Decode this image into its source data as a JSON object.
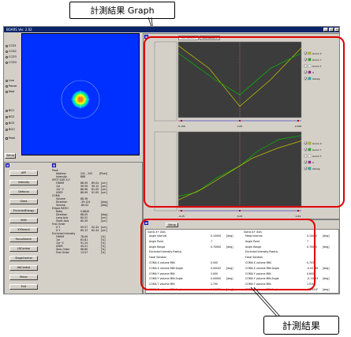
{
  "callouts": {
    "graph": "計測結果 Graph",
    "results": "計測結果"
  },
  "window": {
    "title": "BOARS Ver. 2.02"
  },
  "camera_radios": [
    "CCD1",
    "CCD2",
    "CCD3",
    "CCD4"
  ],
  "mode_radios": [
    "Live",
    "Pause",
    "Mod"
  ],
  "bg_radios": [
    "BG1",
    "BG2",
    "BG3",
    "BGO"
  ],
  "check_peak": "Peak",
  "setup_label": "Setup",
  "left_buttons": [
    "APP",
    "Intensity",
    "Defocus",
    "Glass",
    "EncircledEnergy",
    "Shift",
    "XYSearch",
    "FocusSearch",
    "LDControl",
    "StageControl",
    "AttControl",
    "Mirror",
    "Exit"
  ],
  "params": {
    "peak_title": "Peak",
    "address_label": "Address",
    "address_value": "241 , 242",
    "address_unit": "[Pixel]",
    "intensity_label": "Intensity",
    "intensity_value": "888",
    "spot_size_title": "SPOT SIZE X,Y",
    "rows1": [
      {
        "label": "FWHM",
        "v1": "88.59",
        "v2": "89.04",
        "unit": "[um]"
      },
      {
        "label": "1/e",
        "v1": "99.59",
        "v2": "99.12",
        "unit": "[um]"
      },
      {
        "label": "1/e^2",
        "v1": "88.96",
        "v2": "81.05",
        "unit": "[um]"
      },
      {
        "label": "USER",
        "v1": "88.99",
        "v2": "91.00",
        "unit": "[um]"
      }
    ],
    "coma_title": "COMA",
    "rows2": [
      {
        "label": "Volume",
        "v1": "88.36",
        "unit": ""
      },
      {
        "label": "Direction",
        "v1": "-39.124",
        "unit": "[deg]"
      },
      {
        "label": "Volume",
        "v1": "-80.02",
        "unit": "[deg]"
      }
    ],
    "ellipse_title": "Ellipse RATIO",
    "rows3": [
      {
        "label": "Ratio",
        "v1": "0.8845",
        "unit": ""
      },
      {
        "label": "Direction",
        "v1": "68.05",
        "unit": "[deg]"
      },
      {
        "label": "Long Axis",
        "v1": "80.52",
        "unit": "[um]"
      },
      {
        "label": "Short Axis",
        "v1": "80.59",
        "unit": "[um]"
      }
    ],
    "first_order_title": "First Order",
    "rows4": [
      {
        "label": "X    Y",
        "v1": "95.57",
        "v2": "92.44",
        "unit": "[um]"
      },
      {
        "label": "X    Y",
        "v1": "65.13",
        "v2": "62.44",
        "unit": "[um]"
      }
    ],
    "encircled_title": "Encircled Intensity",
    "rows5": [
      {
        "label": "FWHM",
        "v1": "78.09",
        "unit": "[%]"
      },
      {
        "label": "1/e",
        "v1": "63.81",
        "unit": "[%]"
      },
      {
        "label": "1/e^2",
        "v1": "91.24",
        "unit": "[%]"
      },
      {
        "label": "USER",
        "v1": "45.01",
        "unit": "[%]"
      },
      {
        "label": "Zero Order",
        "v1": "98.80",
        "unit": "[%]"
      },
      {
        "label": "First Order",
        "v1": "13.07",
        "unit": "[%]"
      }
    ]
  },
  "tabs": [
    "Lsm Gonio X",
    "Lsm Gonio Y"
  ],
  "chart1": {
    "x_ticks": [
      "-0.156",
      "0.05",
      "0.456"
    ],
    "legend": [
      {
        "name": "Gonio X",
        "color": "#c8c800",
        "checked": true
      },
      {
        "name": "Gonio Y",
        "color": "#00c000",
        "checked": true
      },
      {
        "name": "Gonio T",
        "color": "#ffffff",
        "checked": false
      },
      {
        "name": "X",
        "color": "#c000c0",
        "checked": true
      },
      {
        "name": "XeCap",
        "color": "#00c0c0",
        "checked": true
      }
    ]
  },
  "chart2": {
    "x_ticks": [
      "-0.25",
      "0.05",
      "0.25"
    ],
    "legend": [
      {
        "name": "Gonio X",
        "color": "#c8c800",
        "checked": true
      },
      {
        "name": "Gonio Y",
        "color": "#00c000",
        "checked": true
      },
      {
        "name": "Gonio T",
        "color": "#ffffff",
        "checked": false
      },
      {
        "name": "X",
        "color": "#c000c0",
        "checked": true
      },
      {
        "name": "XeCap",
        "color": "#00c0c0",
        "checked": true
      }
    ]
  },
  "results": {
    "setup_btn": "Setup",
    "left_header": "Gonio  X+   Axis",
    "right_header": "Gonio  A+   Axis",
    "left_rows": [
      {
        "label": "Angle Interval",
        "value": "0.10000",
        "unit": "[deg]"
      },
      {
        "label": "Angle Point",
        "value": "7",
        "unit": ""
      },
      {
        "label": "Angle Range",
        "value": "0.70000",
        "unit": "[deg]"
      },
      {
        "label": "Encircled Intensity Radius",
        "value": "",
        "unit": ""
      },
      {
        "label": "Focal Solution",
        "value": "",
        "unit": ""
      },
      {
        "label": "COMA X volume MIN",
        "value": "0.000",
        "unit": ""
      },
      {
        "label": "COMA X volume MIN Angle",
        "value": "0.00042",
        "unit": "[deg]"
      },
      {
        "label": "COMA Y volume MIN",
        "value": "3.000",
        "unit": ""
      },
      {
        "label": "COMA Y volume MIN Angle",
        "value": "0.00000",
        "unit": "[deg]"
      },
      {
        "label": "COMA T volume MIN",
        "value": "2.700",
        "unit": ""
      },
      {
        "label": "COMA T volume MIN Angle",
        "value": "0.11120",
        "unit": "[deg]"
      }
    ],
    "right_rows": [
      {
        "label": "Meas Interval",
        "value": "0.10000",
        "unit": "[deg]"
      },
      {
        "label": "Angle Point",
        "value": "7",
        "unit": ""
      },
      {
        "label": "Angle Range",
        "value": "0.70000",
        "unit": "[deg]"
      },
      {
        "label": "Encircled Intensity Radius",
        "value": "",
        "unit": ""
      },
      {
        "label": "Focal Solution",
        "value": "",
        "unit": ""
      },
      {
        "label": "COMA X volume MIN",
        "value": "0.703",
        "unit": ""
      },
      {
        "label": "COMA X volume MIN Angle",
        "value": "-0.02749",
        "unit": "[deg]"
      },
      {
        "label": "COMA Y volume MIN",
        "value": "0.600",
        "unit": ""
      },
      {
        "label": "COMA Y volume MIN Angle",
        "value": "-0.11653",
        "unit": "[deg]"
      },
      {
        "label": "COMA T volume MIN",
        "value": "1.910",
        "unit": ""
      },
      {
        "label": "COMA T volume MIN Angle",
        "value": "-0.2551F",
        "unit": "[deg]"
      }
    ]
  }
}
